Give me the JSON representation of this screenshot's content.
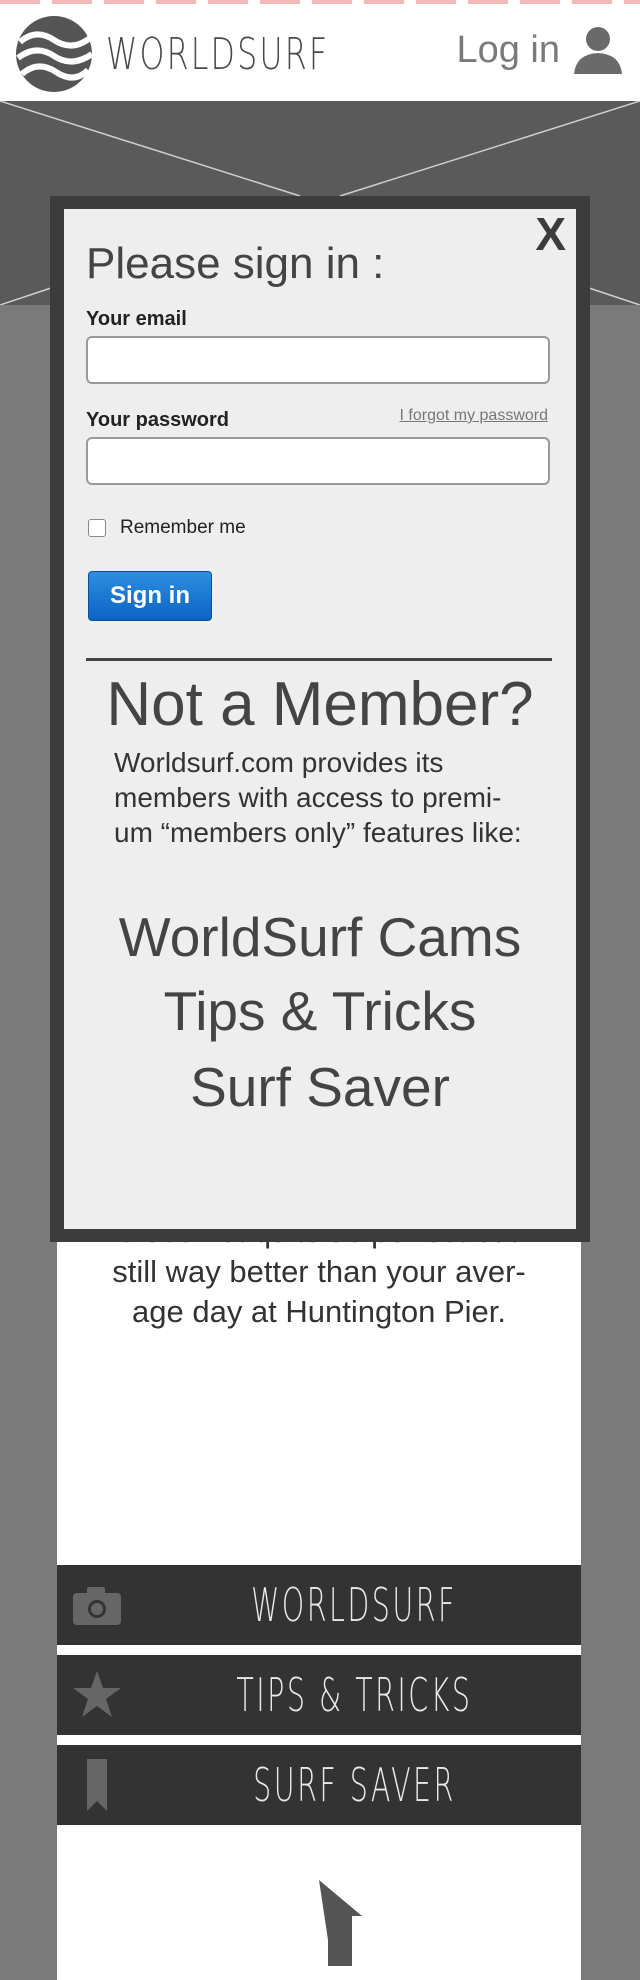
{
  "header": {
    "brand": "WORLDSURF",
    "login_label": "Log in"
  },
  "content": {
    "body_text_1": "that's not quite as perfect but",
    "body_text_2": "still way better than your aver-",
    "body_text_3": "age day at Huntington Pier."
  },
  "features": [
    {
      "label": "WORLDSURF CAMS",
      "icon": "camera-icon"
    },
    {
      "label": "TIPS & TRICKS",
      "icon": "star-icon"
    },
    {
      "label": "SURF SAVER",
      "icon": "bookmark-icon"
    }
  ],
  "modal": {
    "close_label": "X",
    "title": "Please sign in :",
    "email_label": "Your email",
    "email_value": "",
    "password_label": "Your password",
    "password_value": "",
    "forgot_label": "I forgot my password",
    "remember_label": "Remember me",
    "signin_label": "Sign in",
    "not_member_title": "Not a Member?",
    "not_member_text": "Worldsurf.com provides its members with access to premi- um “members only” features like:",
    "perks": [
      "WorldSurf Cams",
      "Tips & Tricks",
      "Surf Saver"
    ]
  },
  "colors": {
    "page_bg": "#7a7a7a",
    "bar_bg": "#333333",
    "button_blue": "#0a64c4"
  }
}
